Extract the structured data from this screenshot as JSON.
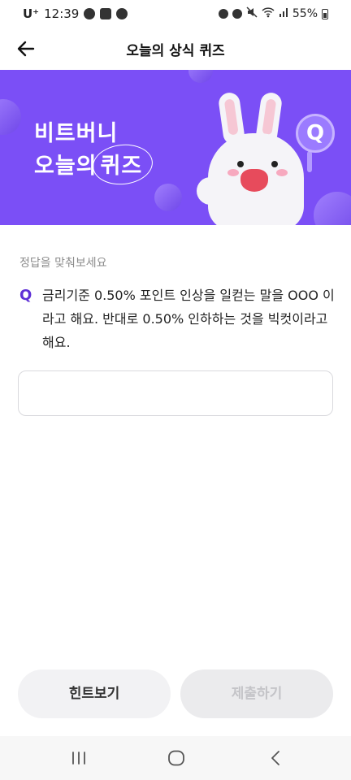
{
  "status_bar": {
    "carrier": "U⁺",
    "time": "12:39",
    "battery": "55%"
  },
  "header": {
    "title": "오늘의 상식 퀴즈",
    "back_icon": "arrow-left-icon"
  },
  "banner": {
    "line1": "비트버니",
    "line2_prefix": "오늘의",
    "line2_highlight": "퀴즈",
    "badge": "Q",
    "background_color": "#7b4ff6"
  },
  "quiz": {
    "instruction": "정답을 맞춰보세요",
    "question_label": "Q",
    "question_text": "금리기준 0.50% 포인트 인상을 일컫는 말을 OOO 이라고 해요. 반대로 0.50% 인하하는 것을 빅컷이라고 해요.",
    "answer_value": "",
    "answer_placeholder": ""
  },
  "buttons": {
    "hint_label": "힌트보기",
    "submit_label": "제출하기"
  },
  "nav_bar": {
    "recent_icon": "recent-apps-icon",
    "home_icon": "home-icon",
    "back_icon": "back-chevron-icon"
  }
}
